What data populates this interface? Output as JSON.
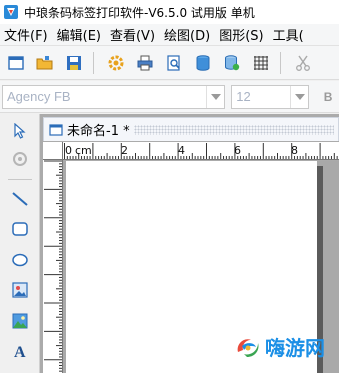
{
  "window": {
    "title": "中琅条码标签打印软件-V6.5.0 试用版 单机"
  },
  "menu": {
    "items": [
      "文件(F)",
      "编辑(E)",
      "查看(V)",
      "绘图(D)",
      "图形(S)",
      "工具("
    ]
  },
  "toolbar": {
    "buttons": [
      "new-document",
      "open-folder",
      "save",
      "settings",
      "print",
      "print-preview",
      "database",
      "database-config",
      "grid",
      "cut"
    ]
  },
  "fontbar": {
    "font_name": "Agency FB",
    "font_size": "12",
    "bold_label": "B"
  },
  "palette": {
    "tools": [
      "pointer",
      "rotate",
      "line",
      "rounded-rectangle",
      "ellipse",
      "image",
      "picture",
      "text"
    ]
  },
  "document": {
    "tab_label": "未命名-1 *",
    "ruler_unit": "cm",
    "h_ticks": [
      "0",
      "2",
      "4",
      "6",
      "8"
    ]
  },
  "watermark": {
    "text": "嗨游网"
  },
  "colors": {
    "accent": "#1b8fe6",
    "canvas_gray": "#ababab",
    "paper": "#ffffff"
  }
}
